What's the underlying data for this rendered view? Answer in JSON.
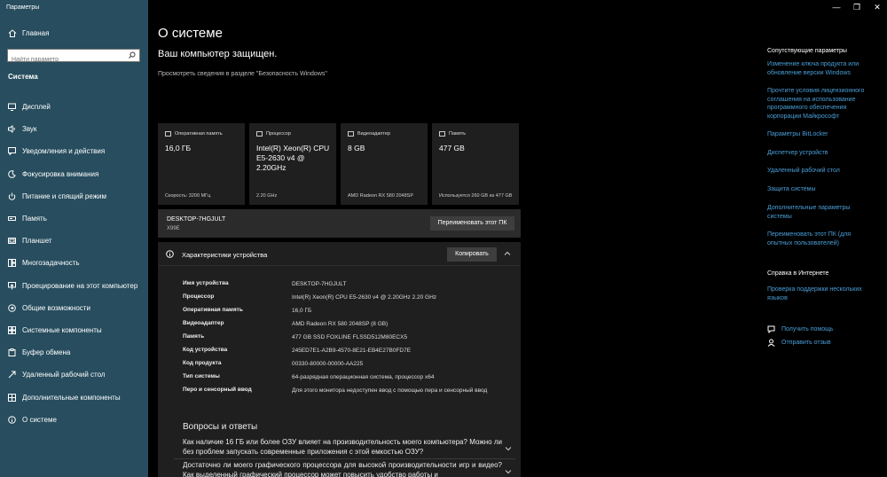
{
  "window": {
    "title": "Параметры",
    "minimize": "—",
    "restore": "❐",
    "close": "✕"
  },
  "sidebar": {
    "home": "Главная",
    "search_placeholder": "Найти параметр",
    "section": "Система",
    "items": [
      {
        "label": "Дисплей",
        "icon": "display-icon"
      },
      {
        "label": "Звук",
        "icon": "sound-icon"
      },
      {
        "label": "Уведомления и действия",
        "icon": "notifications-icon"
      },
      {
        "label": "Фокусировка внимания",
        "icon": "focus-icon"
      },
      {
        "label": "Питание и спящий режим",
        "icon": "power-icon"
      },
      {
        "label": "Память",
        "icon": "storage-icon"
      },
      {
        "label": "Планшет",
        "icon": "tablet-icon"
      },
      {
        "label": "Многозадачность",
        "icon": "multitasking-icon"
      },
      {
        "label": "Проецирование на этот компьютер",
        "icon": "projecting-icon"
      },
      {
        "label": "Общие возможности",
        "icon": "shared-experiences-icon"
      },
      {
        "label": "Системные компоненты",
        "icon": "system-components-icon"
      },
      {
        "label": "Буфер обмена",
        "icon": "clipboard-icon"
      },
      {
        "label": "Удаленный рабочий стол",
        "icon": "remote-desktop-icon"
      },
      {
        "label": "Дополнительные компоненты",
        "icon": "optional-features-icon"
      },
      {
        "label": "О системе",
        "icon": "about-icon"
      }
    ]
  },
  "main": {
    "title": "О системе",
    "protected": "Ваш компьютер защищен.",
    "protected_link": "Просмотреть сведения в разделе \"Безопасность Windows\"",
    "cards": [
      {
        "header": "Оперативная память",
        "value": "16,0 ГБ",
        "sub": "Скорость: 3200 МГц"
      },
      {
        "header": "Процессор",
        "value": "Intel(R) Xeon(R) CPU E5-2630 v4 @ 2.20GHz",
        "sub": "2.20 GHz"
      },
      {
        "header": "Видеоадаптер",
        "value": "8 GB",
        "sub": "AMD Radeon RX 580 2048SP"
      },
      {
        "header": "Память",
        "value": "477 GB",
        "sub": "Используется 260 GB из 477 GB"
      }
    ],
    "device": {
      "name": "DESKTOP-7HGJULT",
      "model": "X99E",
      "rename_button": "Переименовать этот ПК"
    },
    "specs": {
      "title": "Характеристики устройства",
      "copy_button": "Копировать",
      "rows": [
        {
          "label": "Имя устройства",
          "value": "DESKTOP-7HGJULT"
        },
        {
          "label": "Процессор",
          "value": "Intel(R) Xeon(R) CPU E5-2630 v4 @ 2.20GHz   2.20 GHz"
        },
        {
          "label": "Оперативная память",
          "value": "16,0 ГБ"
        },
        {
          "label": "Видеоадаптер",
          "value": "AMD Radeon RX 580 2048SP (8 GB)"
        },
        {
          "label": "Память",
          "value": "477 GB SSD FOXLINE FLSSD512M80ECX5"
        },
        {
          "label": "Код устройства",
          "value": "245ED7E1-A2B9-4570-8E21-EB4E27B0FD7E"
        },
        {
          "label": "Код продукта",
          "value": "00330-80000-00000-AA225"
        },
        {
          "label": "Тип системы",
          "value": "64-разрядная операционная система, процессор x64"
        },
        {
          "label": "Перо и сенсорный ввод",
          "value": "Для этого монитора недоступен ввод с помощью пера и сенсорный ввод"
        }
      ]
    },
    "faq": {
      "title": "Вопросы и ответы",
      "q1": "Как наличие 16 ГБ или более ОЗУ влияет на производительность моего компьютера? Можно ли без проблем запускать современные приложения с этой емкостью ОЗУ?",
      "q2": "Достаточно ли моего графического процессора для высокой производительности игр и видео? Как выделенный графический процессор может повысить удобство работы и"
    }
  },
  "right": {
    "related_title": "Сопутствующие параметры",
    "links": [
      "Изменение ключа продукта или обновление версии Windows",
      "Прочтите условия лицензионного соглашения на использование программного обеспечения корпорации Майкрософт",
      "Параметры BitLocker",
      "Диспетчер устройств",
      "Удаленный рабочий стол",
      "Защита системы",
      "Дополнительные параметры системы",
      "Переименовать этот ПК (для опытных пользователей)"
    ],
    "help_title": "Справка в Интернете",
    "help_link": "Проверка поддержки нескольких языков",
    "get_help": "Получить помощь",
    "feedback": "Отправить отзыв"
  },
  "colors": {
    "sidebar_bg": "#274d5e",
    "link": "#4a9fd9",
    "card_bg": "#1f1f1f",
    "main_bg": "#000000"
  }
}
